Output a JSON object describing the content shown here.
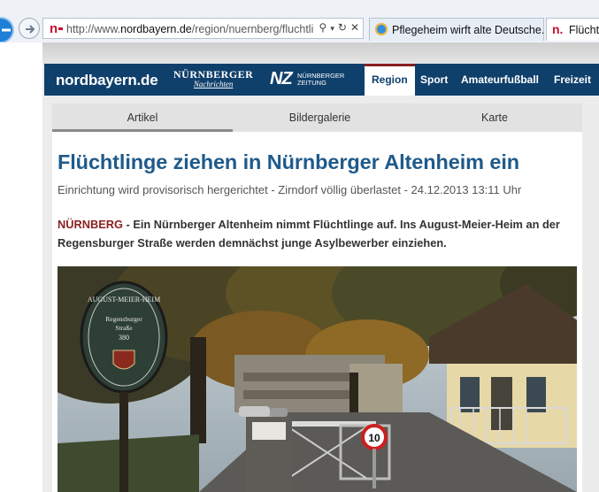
{
  "browser": {
    "url_prefix": "http://www.",
    "url_domain": "nordbayern.de",
    "url_path": "/region/nuernberg/fluchtli",
    "tabs": [
      {
        "label": "Pflegeheim wirft alte Deutsche..."
      },
      {
        "label": "Flüchtl"
      }
    ],
    "favicon_letter": "n."
  },
  "site": {
    "logo": "nordbayern.de",
    "partner1_line1": "NÜRNBERGER",
    "partner1_line2": "Nachrichten",
    "partner2_mark": "NZ",
    "partner2_line1": "NÜRNBERGER",
    "partner2_line2": "ZEITUNG",
    "nav": [
      "Region",
      "Sport",
      "Amateurfußball",
      "Freizeit"
    ]
  },
  "content_tabs": [
    "Artikel",
    "Bildergalerie",
    "Karte"
  ],
  "article": {
    "headline": "Flüchtlinge ziehen in Nürnberger Altenheim ein",
    "subline": "Einrichtung wird provisorisch hergerichtet - Zirndorf völlig überlastet - 24.12.2013 13:11 Uhr",
    "location": "NÜRNBERG",
    "lead": " - Ein Nürnberger Altenheim nimmt Flüchtlinge auf. Ins August-Meier-Heim an der Regensburger Straße werden demnächst junge Asylbewerber einziehen."
  },
  "photo": {
    "sign_line1": "AUGUST-MEIER-HEIM",
    "sign_line2": "Regensburger",
    "sign_line3": "Straße",
    "sign_line4": "380",
    "speed_sign": "10"
  },
  "colors": {
    "nav_bg": "#0f3f6b",
    "headline": "#1f5a8a",
    "location": "#8a1f1f",
    "favicon": "#c8102e"
  }
}
